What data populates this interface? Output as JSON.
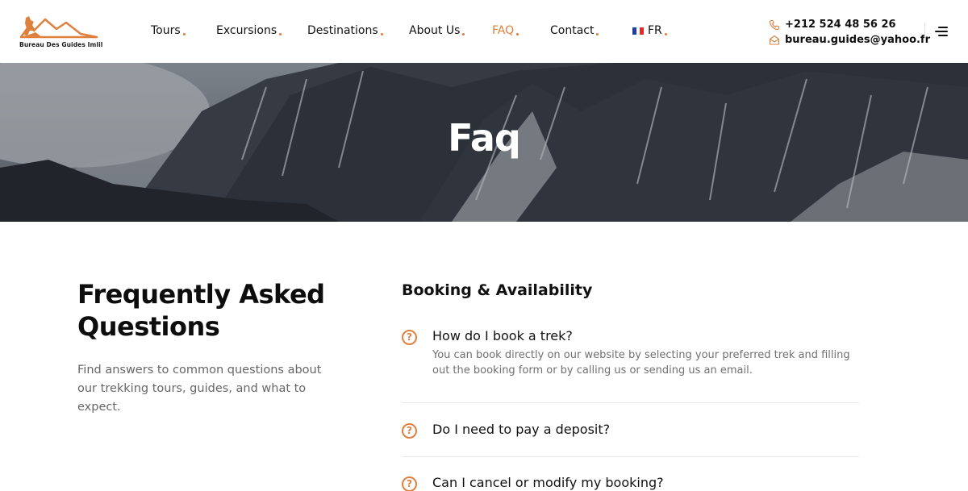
{
  "logo": {
    "text": "Bureau Des Guides Imlil"
  },
  "nav": {
    "items": [
      {
        "label": "Tours"
      },
      {
        "label": "Excursions"
      },
      {
        "label": "Destinations"
      },
      {
        "label": "About Us"
      },
      {
        "label": "FAQ"
      },
      {
        "label": "Contact"
      },
      {
        "label": "FR"
      }
    ],
    "active": "FAQ"
  },
  "contact": {
    "phone": "+212 524 48 56 26",
    "email": "bureau.guides@yahoo.fr"
  },
  "hero": {
    "title": "Faq"
  },
  "intro": {
    "title": "Frequently Asked Questions",
    "text": "Find answers to common questions about our trekking tours, guides, and what to expect."
  },
  "faq": {
    "category": "Booking & Availability",
    "icon_glyph": "?",
    "items": [
      {
        "question": "How do I book a trek?",
        "answer": "You can book directly on our website by selecting your preferred trek and filling out the booking form or by calling us or sending us an email."
      },
      {
        "question": "Do I need to pay a deposit?"
      },
      {
        "question": "Can I cancel or modify my booking?"
      }
    ]
  },
  "colors": {
    "accent": "#e0803f",
    "text": "#111111",
    "muted": "#707070"
  }
}
